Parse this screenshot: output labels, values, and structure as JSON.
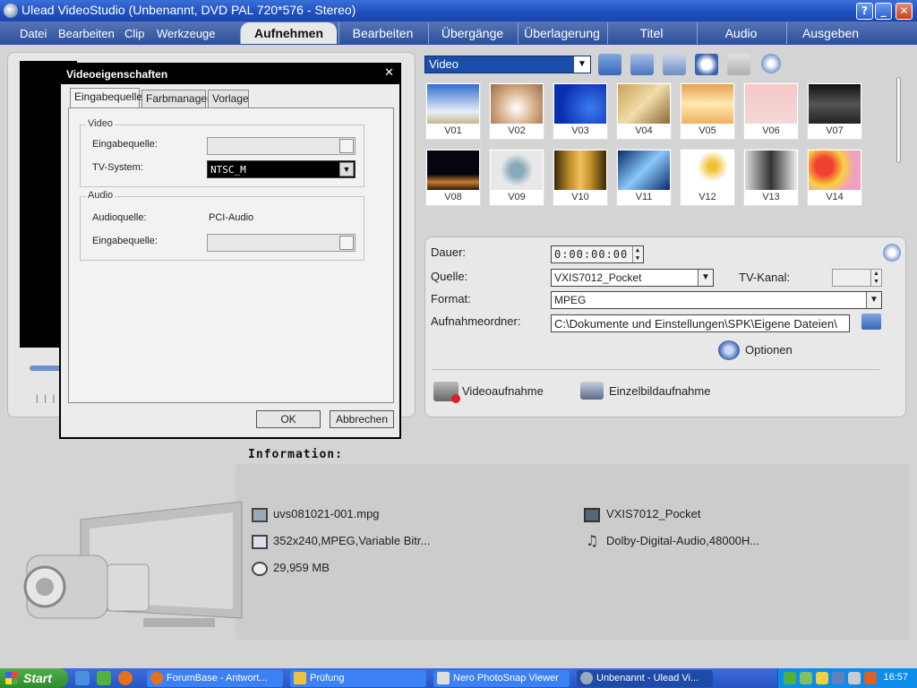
{
  "window": {
    "title": "Ulead VideoStudio (Unbenannt, DVD PAL 720*576 - Stereo)"
  },
  "menu": [
    "Datei",
    "Bearbeiten",
    "Clip",
    "Werkzeuge"
  ],
  "steps": [
    "Aufnehmen",
    "Bearbeiten",
    "Übergänge",
    "Überlagerung",
    "Titel",
    "Audio",
    "Ausgeben"
  ],
  "dialog": {
    "title": "Videoeigenschaften",
    "tabs": [
      "Eingabequelle",
      "Farbmanager",
      "Vorlage"
    ],
    "video_group": "Video",
    "video_input_label": "Eingabequelle:",
    "tv_system_label": "TV-System:",
    "tv_system_value": "NTSC_M",
    "audio_group": "Audio",
    "audio_source_label": "Audioquelle:",
    "audio_source_value": "PCI-Audio",
    "audio_input_label": "Eingabequelle:",
    "ok": "OK",
    "cancel": "Abbrechen"
  },
  "library": {
    "category": "Video",
    "thumbnails": [
      "V01",
      "V02",
      "V03",
      "V04",
      "V05",
      "V06",
      "V07",
      "V08",
      "V09",
      "V10",
      "V11",
      "V12",
      "V13",
      "V14"
    ]
  },
  "capture": {
    "duration_label": "Dauer:",
    "duration_value": "0:00:00:00",
    "source_label": "Quelle:",
    "source_value": "VXIS7012_Pocket",
    "tv_channel_label": "TV-Kanal:",
    "format_label": "Format:",
    "format_value": "MPEG",
    "folder_label": "Aufnahmeordner:",
    "folder_value": "C:\\Dokumente und Einstellungen\\SPK\\Eigene Dateien\\",
    "options": "Optionen",
    "video_capture": "Videoaufnahme",
    "snapshot": "Einzelbildaufnahme"
  },
  "info": {
    "heading": "Information:",
    "filename": "uvs081021-001.mpg",
    "video_format": "352x240,MPEG,Variable Bitr...",
    "size": "29,959 MB",
    "device": "VXIS7012_Pocket",
    "audio_format": "Dolby-Digital-Audio,48000H..."
  },
  "taskbar": {
    "start": "Start",
    "buttons": [
      "ForumBase - Antwort...",
      "Prüfung",
      "Nero PhotoSnap Viewer",
      "Unbenannt - Ulead Vi..."
    ],
    "clock": "16:57"
  }
}
